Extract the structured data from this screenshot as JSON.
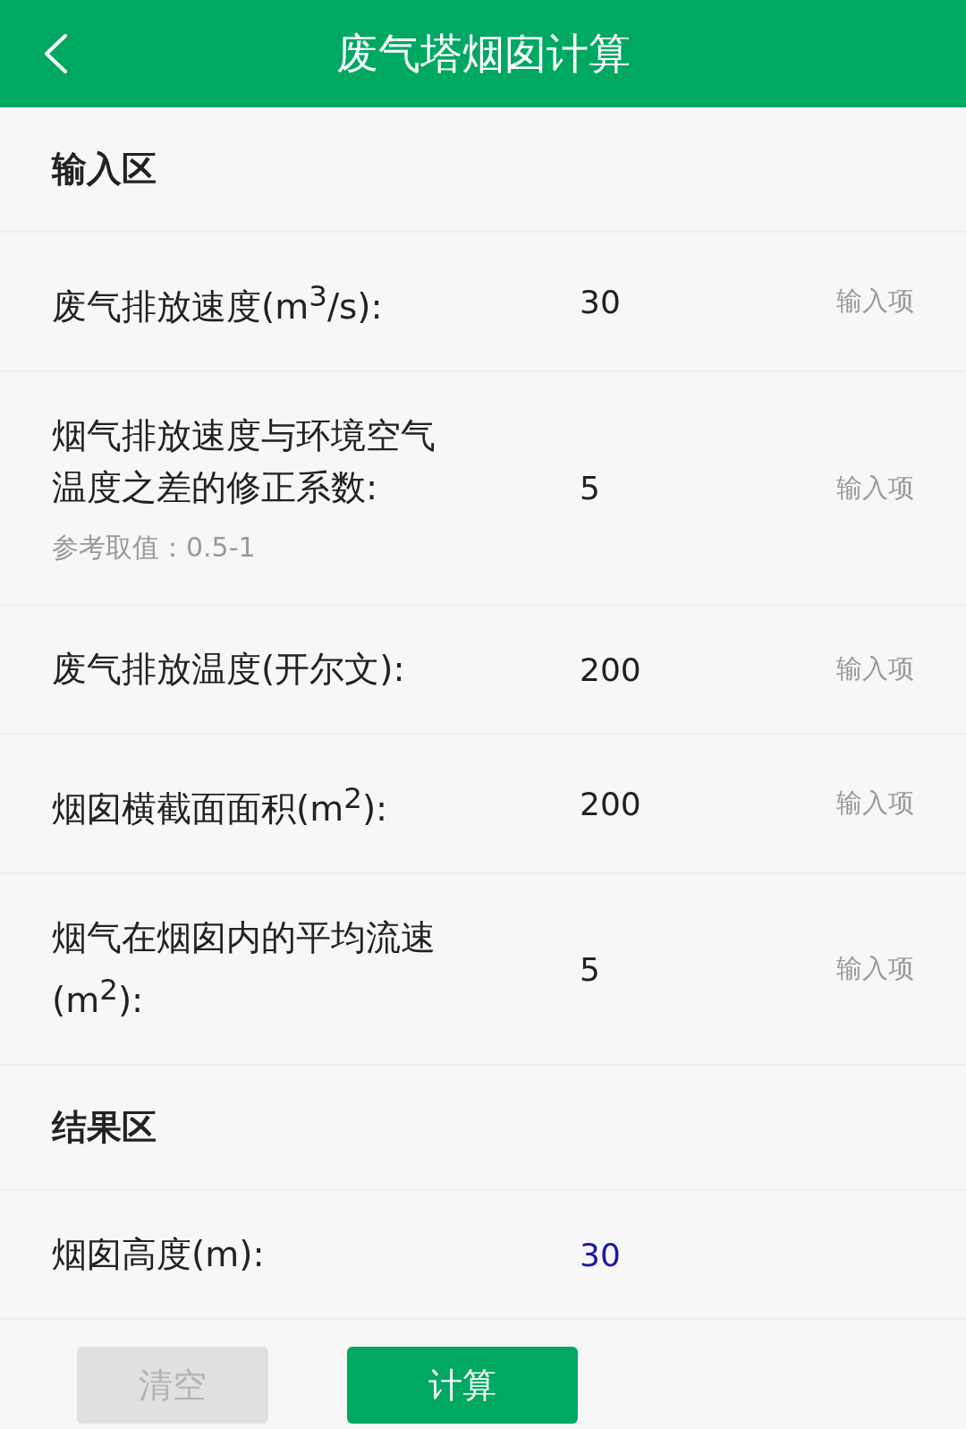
{
  "header": {
    "title": "废气塔烟囱计算"
  },
  "input_section": {
    "title": "输入区",
    "rows": [
      {
        "label": "废气排放速度(m$^{3}$/s):",
        "value": "30",
        "note": "输入项"
      },
      {
        "label": "烟气排放速度与环境空气温度之差的修正系数:",
        "value": "5",
        "note": "输入项",
        "hint": "参考取值：0.5-1"
      },
      {
        "label": "废气排放温度(开尔文):",
        "value": "200",
        "note": "输入项"
      },
      {
        "label": "烟囱横截面面积(m$^{2}$):",
        "value": "200",
        "note": "输入项"
      },
      {
        "label": "烟气在烟囱内的平均流速(m$^{2}$):",
        "value": "5",
        "note": "输入项"
      }
    ]
  },
  "result_section": {
    "title": "结果区",
    "rows": [
      {
        "label": "烟囱高度(m):",
        "value": "30"
      }
    ]
  },
  "buttons": [
    {
      "label": "清空",
      "disabled": true
    },
    {
      "label": "计算",
      "disabled": false
    }
  ]
}
